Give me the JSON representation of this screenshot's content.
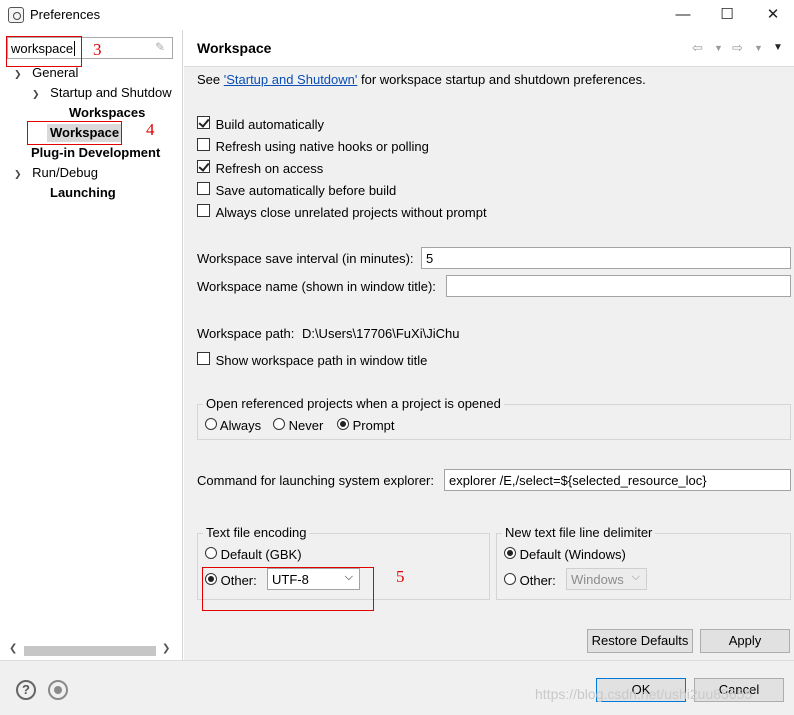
{
  "window": {
    "title": "Preferences",
    "min_label": "—",
    "max_label": "☐",
    "close_label": "✕"
  },
  "filter": {
    "value": "workspace"
  },
  "tree": {
    "general": "General",
    "startup": "Startup and Shutdow",
    "workspaces": "Workspaces",
    "workspace": "Workspace",
    "plugin": "Plug-in Development",
    "rundebug": "Run/Debug",
    "launching": "Launching"
  },
  "annotations": {
    "a3": "3",
    "a4": "4",
    "a5": "5"
  },
  "page": {
    "title": "Workspace",
    "see_prefix": "See ",
    "see_link": "'Startup and Shutdown'",
    "see_suffix": " for workspace startup and shutdown preferences."
  },
  "checkboxes": [
    {
      "label": "Build automatically",
      "checked": true
    },
    {
      "label": "Refresh using native hooks or polling",
      "checked": false
    },
    {
      "label": "Refresh on access",
      "checked": true
    },
    {
      "label": "Save automatically before build",
      "checked": false
    },
    {
      "label": "Always close unrelated projects without prompt",
      "checked": false
    }
  ],
  "save_interval": {
    "label": "Workspace save interval (in minutes):",
    "value": "5"
  },
  "ws_name": {
    "label": "Workspace name (shown in window title):",
    "value": ""
  },
  "ws_path": {
    "label": "Workspace path:",
    "value": "D:\\Users\\17706\\FuXi\\JiChu"
  },
  "show_path": {
    "label": "Show workspace path in window title",
    "checked": false
  },
  "open_ref": {
    "title": "Open referenced projects when a project is opened",
    "options": [
      "Always",
      "Never",
      "Prompt"
    ],
    "selected": "Prompt"
  },
  "explorer": {
    "label": "Command for launching system explorer:",
    "value": "explorer /E,/select=${selected_resource_loc}"
  },
  "encoding": {
    "title": "Text file encoding",
    "default_label": "Default (GBK)",
    "other_label": "Other:",
    "other_value": "UTF-8",
    "selected": "other"
  },
  "delimiter": {
    "title": "New text file line delimiter",
    "default_label": "Default (Windows)",
    "other_label": "Other:",
    "other_value": "Windows",
    "selected": "default"
  },
  "buttons": {
    "restore": "Restore Defaults",
    "apply": "Apply",
    "ok": "OK",
    "cancel": "Cancel"
  },
  "watermark": "https://blog.csdn.net/ushi2uu85655",
  "colors": {
    "annotation": "#e00000",
    "link": "#0a4eb5",
    "selected_tree": "#d9d9d9"
  }
}
